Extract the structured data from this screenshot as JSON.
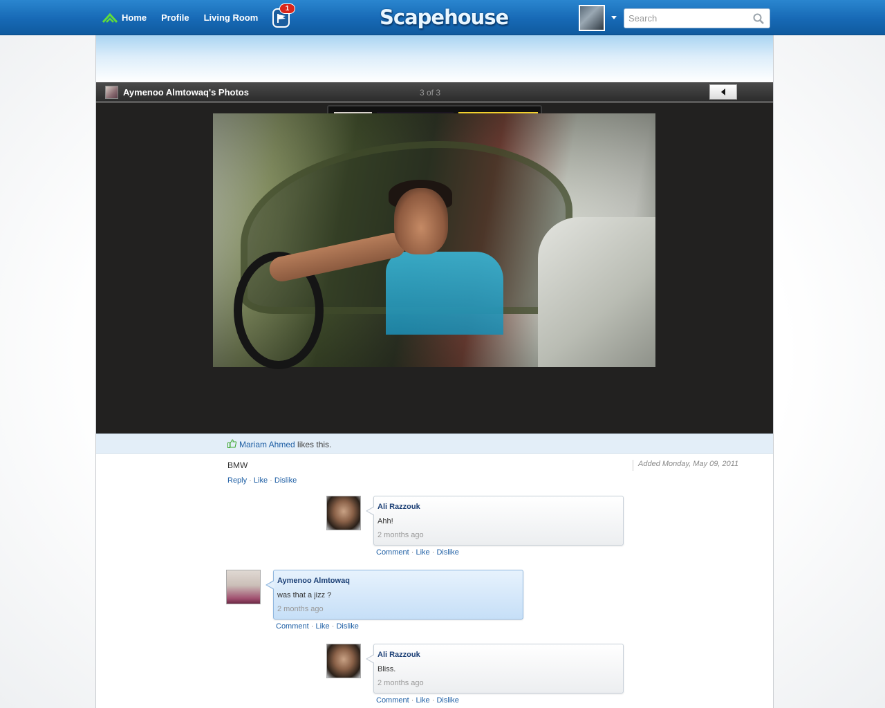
{
  "nav": {
    "home": "Home",
    "profile": "Profile",
    "living_room": "Living Room",
    "notification_count": "1"
  },
  "brand": {
    "logo_text": "Scapehouse",
    "accent": "#1769b5"
  },
  "search": {
    "placeholder": "Search",
    "value": ""
  },
  "album": {
    "owner_title": "Aymenoo Almtowaq's Photos",
    "counter": "3 of 3",
    "thumbnails": [
      "thumb-1",
      "thumb-2",
      "thumb-3-selected"
    ]
  },
  "likes": {
    "name": "Mariam Ahmed",
    "suffix": " likes this."
  },
  "photo": {
    "caption": "BMW",
    "added": "Added Monday, May 09, 2011",
    "actions": {
      "reply": "Reply",
      "like": "Like",
      "dislike": "Dislike"
    }
  },
  "comments": [
    {
      "author": "Ali Razzouk",
      "text": "Ahh!",
      "time": "2 months ago"
    },
    {
      "author": "Aymenoo Almtowaq",
      "text": "was that a jizz ?",
      "time": "2 months ago"
    },
    {
      "author": "Ali Razzouk",
      "text": "Bliss.",
      "time": "2 months ago"
    }
  ],
  "comment_actions": {
    "comment": "Comment",
    "like": "Like",
    "dislike": "Dislike"
  },
  "separator": " · "
}
